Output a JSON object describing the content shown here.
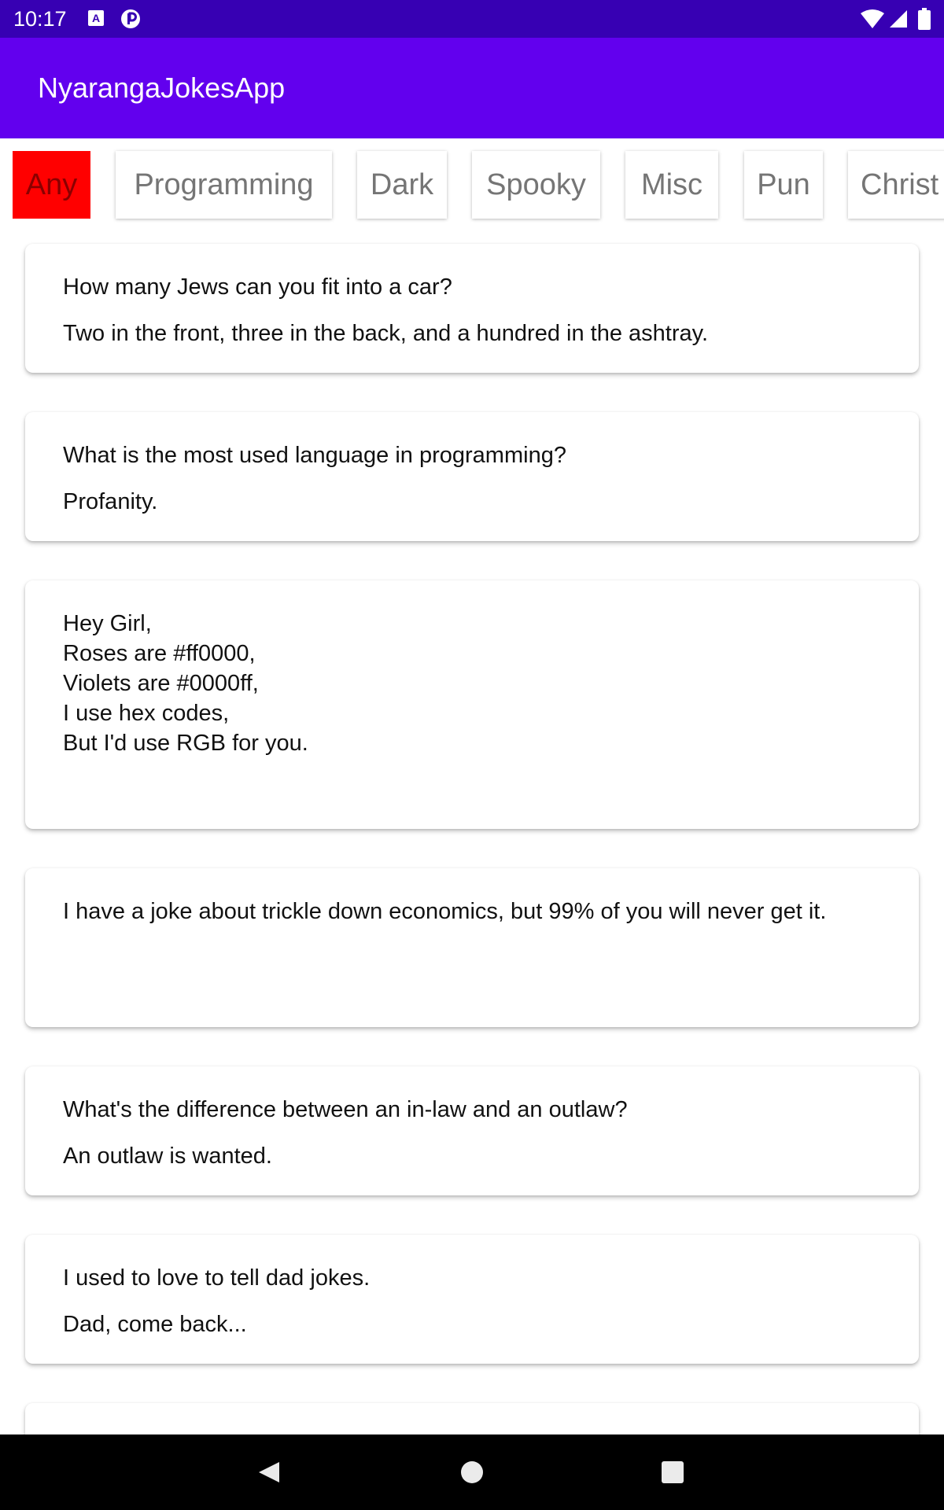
{
  "status_bar": {
    "time": "10:17",
    "icons": [
      "a-notification-icon",
      "p-notification-icon",
      "wifi-icon",
      "signal-icon",
      "battery-icon"
    ],
    "a_icon_glyph": "A"
  },
  "app_bar": {
    "title": "NyarangaJokesApp",
    "color": "#6200ee"
  },
  "categories": {
    "selected": "Any",
    "selected_color": "#ff0000",
    "items": [
      "Any",
      "Programming",
      "Dark",
      "Spooky",
      "Misc",
      "Pun",
      "Christ"
    ]
  },
  "jokes": [
    {
      "setup": "How many Jews can you fit into a car?",
      "delivery": "Two in the front, three in the back, and a hundred in the ashtray."
    },
    {
      "setup": "What is the most used language in programming?",
      "delivery": "Profanity."
    },
    {
      "joke": "Hey Girl,\nRoses are #ff0000,\nViolets are #0000ff,\nI use hex codes,\nBut I'd use RGB for you."
    },
    {
      "joke": "I have a joke about trickle down economics, but 99% of you will never get it."
    },
    {
      "setup": "What's the difference between an in-law and an outlaw?",
      "delivery": "An outlaw is wanted."
    },
    {
      "setup": "I used to love to tell dad jokes.",
      "delivery": "Dad, come back..."
    }
  ],
  "nav_bar": {
    "icons": [
      "back-icon",
      "home-icon",
      "recents-icon"
    ]
  }
}
